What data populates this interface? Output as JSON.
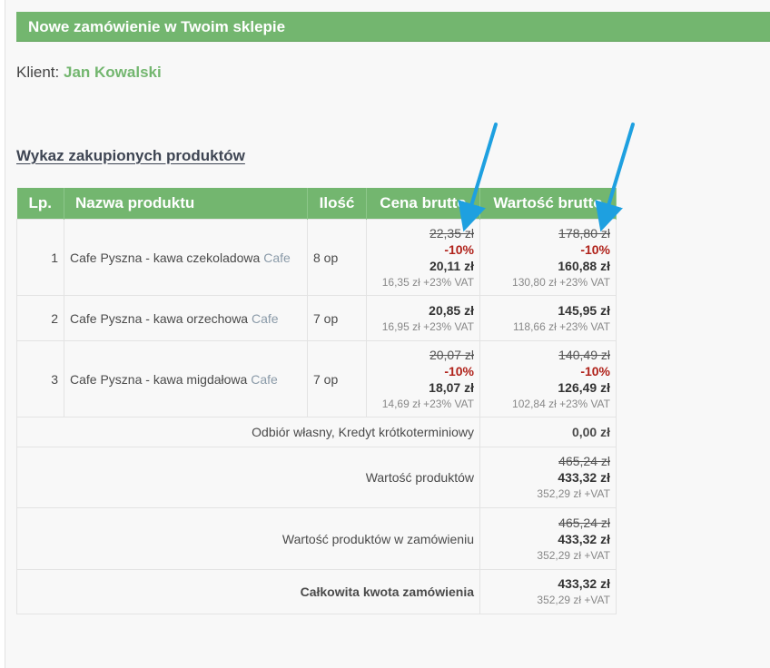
{
  "header": {
    "title": "Nowe zamówienie w Twoim sklepie"
  },
  "client": {
    "label": "Klient:",
    "name": "Jan Kowalski"
  },
  "section": {
    "title": "Wykaz zakupionych produktów"
  },
  "table": {
    "headers": [
      "Lp.",
      "Nazwa produktu",
      "Ilość",
      "Cena brutto",
      "Wartość brutto"
    ],
    "rows": [
      {
        "lp": "1",
        "name": "Cafe Pyszna - kawa czekoladowa",
        "category": "Cafe",
        "qty": "8 op",
        "price_old": "22,35 zł",
        "price_discount": "-10%",
        "price_final": "20,11 zł",
        "price_net": "16,35 zł +23% VAT",
        "value_old": "178,80 zł",
        "value_discount": "-10%",
        "value_final": "160,88 zł",
        "value_net": "130,80 zł +23% VAT"
      },
      {
        "lp": "2",
        "name": "Cafe Pyszna - kawa orzechowa",
        "category": "Cafe",
        "qty": "7 op",
        "price_final": "20,85 zł",
        "price_net": "16,95 zł +23% VAT",
        "value_final": "145,95 zł",
        "value_net": "118,66 zł +23% VAT"
      },
      {
        "lp": "3",
        "name": "Cafe Pyszna - kawa migdałowa",
        "category": "Cafe",
        "qty": "7 op",
        "price_old": "20,07 zł",
        "price_discount": "-10%",
        "price_final": "18,07 zł",
        "price_net": "14,69 zł +23% VAT",
        "value_old": "140,49 zł",
        "value_discount": "-10%",
        "value_final": "126,49 zł",
        "value_net": "102,84 zł +23% VAT"
      }
    ],
    "shipping": {
      "label": "Odbiór własny, Kredyt krótkoterminiowy",
      "value": "0,00 zł"
    },
    "products_value": {
      "label": "Wartość produktów",
      "old": "465,24 zł",
      "final": "433,32 zł",
      "net": "352,29 zł +VAT"
    },
    "order_products_value": {
      "label": "Wartość produktów w zamówieniu",
      "old": "465,24 zł",
      "final": "433,32 zł",
      "net": "352,29 zł +VAT"
    },
    "total": {
      "label": "Całkowita kwota zamówienia",
      "final": "433,32 zł",
      "net": "352,29 zł +VAT"
    }
  },
  "colors": {
    "accent": "#73b66f",
    "discount": "#b0221a",
    "arrow": "#1ea0e0"
  }
}
